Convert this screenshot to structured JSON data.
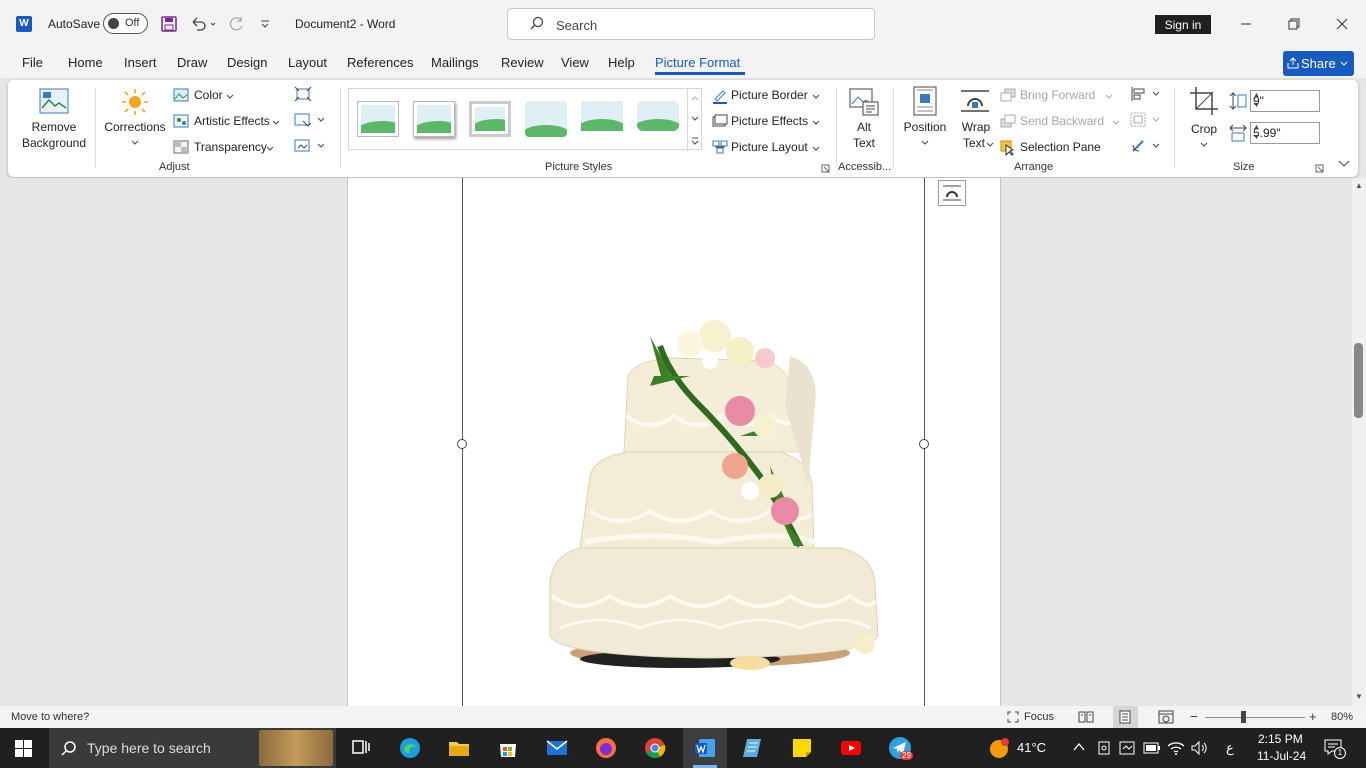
{
  "titlebar": {
    "app_logo": "W",
    "autosave_label": "AutoSave",
    "autosave_state": "Off",
    "document_title": "Document2  -  Word",
    "search_placeholder": "Search",
    "signin_label": "Sign in"
  },
  "menubar": {
    "tabs": [
      "File",
      "Home",
      "Insert",
      "Draw",
      "Design",
      "Layout",
      "References",
      "Mailings",
      "Review",
      "View",
      "Help",
      "Picture Format"
    ],
    "active_tab": "Picture Format",
    "share_label": "Share"
  },
  "ribbon": {
    "adjust": {
      "remove_background_line1": "Remove",
      "remove_background_line2": "Background",
      "corrections": "Corrections",
      "color": "Color",
      "artistic_effects": "Artistic Effects",
      "transparency": "Transparency",
      "label": "Adjust"
    },
    "picture_styles": {
      "picture_border": "Picture Border",
      "picture_effects": "Picture Effects",
      "picture_layout": "Picture Layout",
      "label": "Picture Styles"
    },
    "accessibility": {
      "alt_text_line1": "Alt",
      "alt_text_line2": "Text",
      "label": "Accessib..."
    },
    "arrange": {
      "position": "Position",
      "wrap_text_line1": "Wrap",
      "wrap_text_line2": "Text",
      "bring_forward": "Bring Forward",
      "send_backward": "Send Backward",
      "selection_pane": "Selection Pane",
      "label": "Arrange"
    },
    "size": {
      "crop": "Crop",
      "height": "9\"",
      "width": "5.99\"",
      "label": "Size"
    }
  },
  "statusbar": {
    "message": "Move to where?",
    "focus": "Focus",
    "zoom": "80%"
  },
  "taskbar": {
    "search_placeholder": "Type here to search",
    "temperature": "41°C",
    "time": "2:15 PM",
    "date": "11-Jul-24",
    "telegram_badge": "29",
    "notifications_count": "1",
    "language": "ع"
  },
  "colors": {
    "accent": "#185abd",
    "titlebar_bg": "#f3f3f3",
    "taskbar_bg": "#202020"
  }
}
